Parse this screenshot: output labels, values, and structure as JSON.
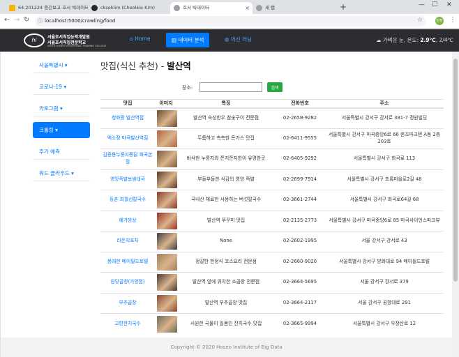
{
  "browser": {
    "tabs": [
      {
        "label": "64.201224 중간보고 호서 빅데이터",
        "color": "#f4b400"
      },
      {
        "label": "ckseklim (Cheolkie Kim)",
        "color": "#24292e"
      },
      {
        "label": "호서 빅데이터",
        "color": "#9e9e9e"
      },
      {
        "label": "새 탭",
        "color": "#9e9e9e"
      }
    ],
    "url": "localhost:5000/crawling/food",
    "profile": "원정"
  },
  "nav": {
    "logo_line1": "서울호서직업능력개발원",
    "logo_line2": "서울호서직업전문학교",
    "logo_line3": "SEOUL HOSEO VOCATIONAL TRAINING COLLEGE",
    "links": [
      "Home",
      "데이터 분석",
      "머신 러닝"
    ],
    "weather_prefix": "가벼운 눈, 온도: ",
    "weather_value": "2.9℃",
    "weather_suffix": ", 2/4℃"
  },
  "sidebar": [
    "서울특별시",
    "코로나-19",
    "카토그램",
    "크롤링",
    "주가 예측",
    "워드 클라우드"
  ],
  "heading": {
    "prefix": "맛집(식신 추천) - ",
    "place": "발산역"
  },
  "search": {
    "label": "장소:",
    "button": "검색",
    "value": ""
  },
  "table": {
    "headers": [
      "맛집",
      "이미지",
      "특징",
      "전화번호",
      "주소"
    ],
    "rows": [
      {
        "name": "청화랑 발산역점",
        "feature": "발산역 숙성한우 참숯구이 전문점",
        "phone": "02-2658-9282",
        "address": "서울특별시 강서구 강서로 381-7 정원빌딩",
        "img": "#6b4a2e"
      },
      {
        "name": "엑소정 마곡발산역점",
        "feature": "두툼하고 촉촉한 돈가스 맛집",
        "phone": "02-6411-9555",
        "address": "서울특별시 강서구 마곡중앙6로 66 퀸즈파크텐 A동 2층 203호",
        "img": "#b5643a"
      },
      {
        "name": "김중용누룽지통닭 화곡본점",
        "feature": "바삭한 누룽지와 쫀지쫀지한이 유명한곳",
        "phone": "02-6405-9292",
        "address": "서울특별시 강서구 화곡로 113",
        "img": "#7a5a3c"
      },
      {
        "name": "영앙족발보쌈대국",
        "feature": "부들부들한 식감의 영양 족발",
        "phone": "02-2699-7914",
        "address": "서울특별시 강서구 초록마을로2길 48",
        "img": "#5c3b26"
      },
      {
        "name": "등촌 최월선칼국수",
        "feature": "국내산 재료만 사용하는 버섯칼국수",
        "phone": "02-3661-2744",
        "address": "서울특별시 강서구 화곡로64길 68",
        "img": "#8a3a2a"
      },
      {
        "name": "예가방상",
        "feature": "발산역 쭈꾸미 맛집",
        "phone": "02-2135-2773",
        "address": "서울특별시 강서구 마곡중앙6로 85 마곡사이언스파크뷰",
        "img": "#9b2f24"
      },
      {
        "name": "라온지포차",
        "feature": "None",
        "phone": "02-2602-1995",
        "address": "서울 강서구 강서로 43",
        "img": "#3b3f44"
      },
      {
        "name": "봉래헌 메이필드호텔",
        "feature": "정갈한 한정식 코스요리 전문점",
        "phone": "02-2660-9020",
        "address": "서울특별시 강서구 방화대로 94 메이필드호텔",
        "img": "#a08060"
      },
      {
        "name": "원당곱창(가양점)",
        "feature": "발산역 앞에 위치한 소곱창 전문점",
        "phone": "02-3664-5695",
        "address": "서울 강서구 강서로 379",
        "img": "#4a3a30"
      },
      {
        "name": "부추곱창",
        "feature": "발산역 부추곱창 맛집",
        "phone": "02-3664-2117",
        "address": "서울 강서구 공항대로 291",
        "img": "#8c4a30"
      },
      {
        "name": "고향찬치국수",
        "feature": "시원한 국물이 일품인 잔치국수 맛집",
        "phone": "02-3665-9994",
        "address": "서울특별시 강서구 우장산로 12",
        "img": "#6f6a5a"
      }
    ]
  },
  "footer": "Copyright © 2020 Hoseo Institute of Big Data"
}
